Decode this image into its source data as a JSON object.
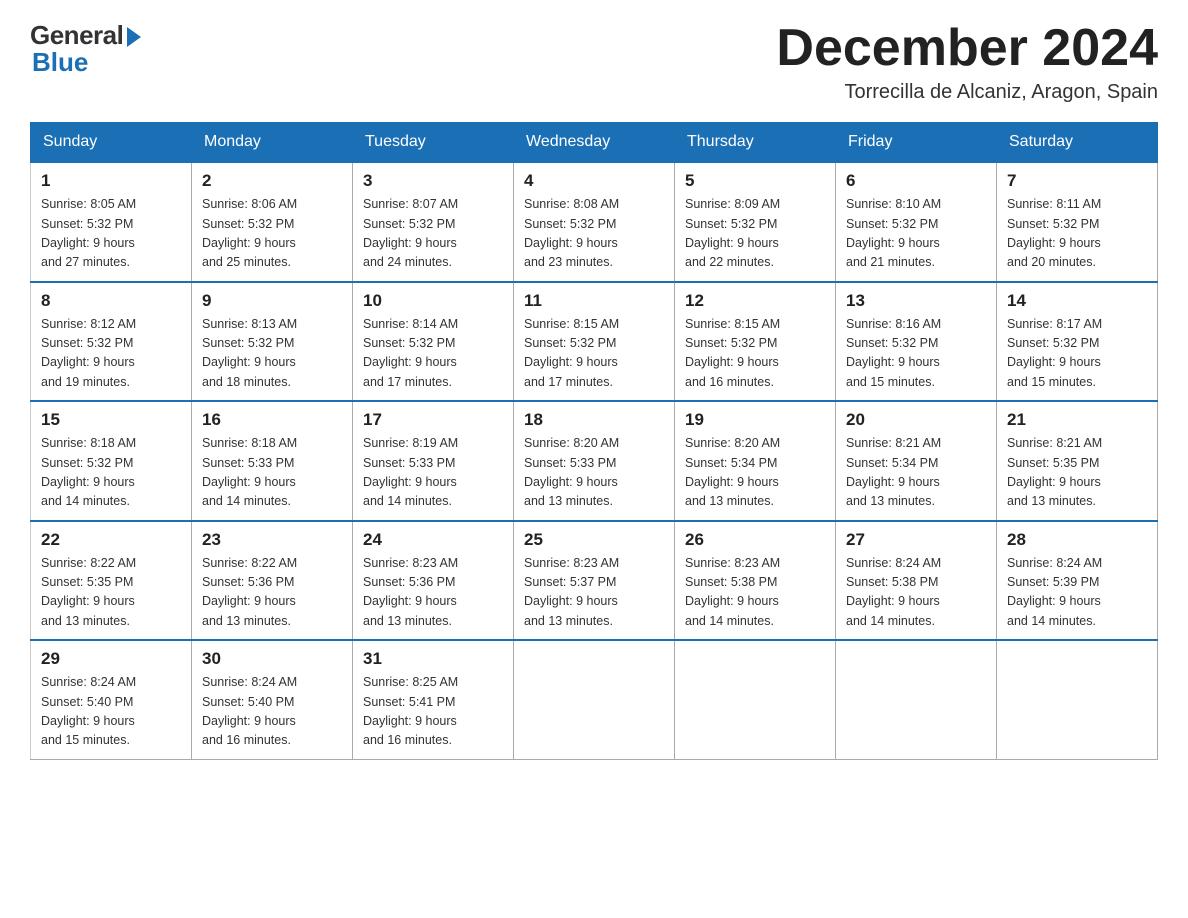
{
  "header": {
    "logo_general": "General",
    "logo_blue": "Blue",
    "month_year": "December 2024",
    "location": "Torrecilla de Alcaniz, Aragon, Spain"
  },
  "days_of_week": [
    "Sunday",
    "Monday",
    "Tuesday",
    "Wednesday",
    "Thursday",
    "Friday",
    "Saturday"
  ],
  "weeks": [
    [
      {
        "day": "1",
        "sunrise": "8:05 AM",
        "sunset": "5:32 PM",
        "daylight": "9 hours and 27 minutes."
      },
      {
        "day": "2",
        "sunrise": "8:06 AM",
        "sunset": "5:32 PM",
        "daylight": "9 hours and 25 minutes."
      },
      {
        "day": "3",
        "sunrise": "8:07 AM",
        "sunset": "5:32 PM",
        "daylight": "9 hours and 24 minutes."
      },
      {
        "day": "4",
        "sunrise": "8:08 AM",
        "sunset": "5:32 PM",
        "daylight": "9 hours and 23 minutes."
      },
      {
        "day": "5",
        "sunrise": "8:09 AM",
        "sunset": "5:32 PM",
        "daylight": "9 hours and 22 minutes."
      },
      {
        "day": "6",
        "sunrise": "8:10 AM",
        "sunset": "5:32 PM",
        "daylight": "9 hours and 21 minutes."
      },
      {
        "day": "7",
        "sunrise": "8:11 AM",
        "sunset": "5:32 PM",
        "daylight": "9 hours and 20 minutes."
      }
    ],
    [
      {
        "day": "8",
        "sunrise": "8:12 AM",
        "sunset": "5:32 PM",
        "daylight": "9 hours and 19 minutes."
      },
      {
        "day": "9",
        "sunrise": "8:13 AM",
        "sunset": "5:32 PM",
        "daylight": "9 hours and 18 minutes."
      },
      {
        "day": "10",
        "sunrise": "8:14 AM",
        "sunset": "5:32 PM",
        "daylight": "9 hours and 17 minutes."
      },
      {
        "day": "11",
        "sunrise": "8:15 AM",
        "sunset": "5:32 PM",
        "daylight": "9 hours and 17 minutes."
      },
      {
        "day": "12",
        "sunrise": "8:15 AM",
        "sunset": "5:32 PM",
        "daylight": "9 hours and 16 minutes."
      },
      {
        "day": "13",
        "sunrise": "8:16 AM",
        "sunset": "5:32 PM",
        "daylight": "9 hours and 15 minutes."
      },
      {
        "day": "14",
        "sunrise": "8:17 AM",
        "sunset": "5:32 PM",
        "daylight": "9 hours and 15 minutes."
      }
    ],
    [
      {
        "day": "15",
        "sunrise": "8:18 AM",
        "sunset": "5:32 PM",
        "daylight": "9 hours and 14 minutes."
      },
      {
        "day": "16",
        "sunrise": "8:18 AM",
        "sunset": "5:33 PM",
        "daylight": "9 hours and 14 minutes."
      },
      {
        "day": "17",
        "sunrise": "8:19 AM",
        "sunset": "5:33 PM",
        "daylight": "9 hours and 14 minutes."
      },
      {
        "day": "18",
        "sunrise": "8:20 AM",
        "sunset": "5:33 PM",
        "daylight": "9 hours and 13 minutes."
      },
      {
        "day": "19",
        "sunrise": "8:20 AM",
        "sunset": "5:34 PM",
        "daylight": "9 hours and 13 minutes."
      },
      {
        "day": "20",
        "sunrise": "8:21 AM",
        "sunset": "5:34 PM",
        "daylight": "9 hours and 13 minutes."
      },
      {
        "day": "21",
        "sunrise": "8:21 AM",
        "sunset": "5:35 PM",
        "daylight": "9 hours and 13 minutes."
      }
    ],
    [
      {
        "day": "22",
        "sunrise": "8:22 AM",
        "sunset": "5:35 PM",
        "daylight": "9 hours and 13 minutes."
      },
      {
        "day": "23",
        "sunrise": "8:22 AM",
        "sunset": "5:36 PM",
        "daylight": "9 hours and 13 minutes."
      },
      {
        "day": "24",
        "sunrise": "8:23 AM",
        "sunset": "5:36 PM",
        "daylight": "9 hours and 13 minutes."
      },
      {
        "day": "25",
        "sunrise": "8:23 AM",
        "sunset": "5:37 PM",
        "daylight": "9 hours and 13 minutes."
      },
      {
        "day": "26",
        "sunrise": "8:23 AM",
        "sunset": "5:38 PM",
        "daylight": "9 hours and 14 minutes."
      },
      {
        "day": "27",
        "sunrise": "8:24 AM",
        "sunset": "5:38 PM",
        "daylight": "9 hours and 14 minutes."
      },
      {
        "day": "28",
        "sunrise": "8:24 AM",
        "sunset": "5:39 PM",
        "daylight": "9 hours and 14 minutes."
      }
    ],
    [
      {
        "day": "29",
        "sunrise": "8:24 AM",
        "sunset": "5:40 PM",
        "daylight": "9 hours and 15 minutes."
      },
      {
        "day": "30",
        "sunrise": "8:24 AM",
        "sunset": "5:40 PM",
        "daylight": "9 hours and 16 minutes."
      },
      {
        "day": "31",
        "sunrise": "8:25 AM",
        "sunset": "5:41 PM",
        "daylight": "9 hours and 16 minutes."
      },
      null,
      null,
      null,
      null
    ]
  ],
  "labels": {
    "sunrise": "Sunrise:",
    "sunset": "Sunset:",
    "daylight": "Daylight:"
  }
}
